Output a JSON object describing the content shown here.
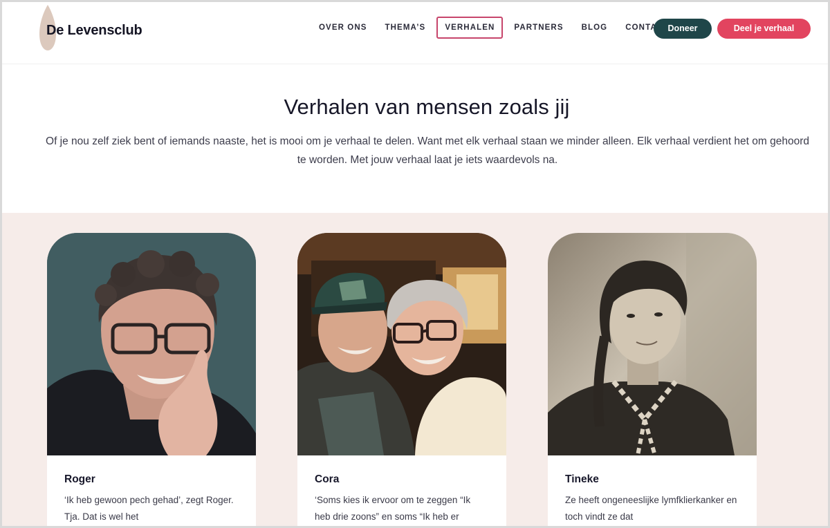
{
  "header": {
    "logo_text": "De Levensclub",
    "nav": [
      {
        "label": "OVER ONS",
        "active": false
      },
      {
        "label": "THEMA’S",
        "active": false
      },
      {
        "label": "VERHALEN",
        "active": true
      },
      {
        "label": "PARTNERS",
        "active": false
      },
      {
        "label": "BLOG",
        "active": false
      },
      {
        "label": "CONTACT",
        "active": false
      }
    ],
    "donate_label": "Doneer",
    "share_label": "Deel je verhaal"
  },
  "hero": {
    "title": "Verhalen van mensen zoals jij",
    "text": "Of je nou zelf ziek bent of iemands naaste, het is mooi om je verhaal te delen. Want met elk verhaal staan we minder alleen. Elk verhaal verdient het om gehoord te worden. Met jouw verhaal laat je iets waardevols na."
  },
  "stories": [
    {
      "name": "Roger",
      "excerpt": "‘Ik heb gewoon pech gehad’, zegt Roger. Tja. Dat is wel het"
    },
    {
      "name": "Cora",
      "excerpt": "‘Soms kies ik ervoor om te zeggen “Ik heb drie zoons” en soms “Ik heb er"
    },
    {
      "name": "Tineke",
      "excerpt": "Ze heeft ongeneeslijke lymfklierkanker en toch vindt ze dat"
    }
  ],
  "colors": {
    "primary_teal": "#1f4649",
    "accent_pink": "#e2445f",
    "active_border": "#c7456b",
    "section_bg": "#f6ece9",
    "logo_drop": "#dcc9bd"
  }
}
